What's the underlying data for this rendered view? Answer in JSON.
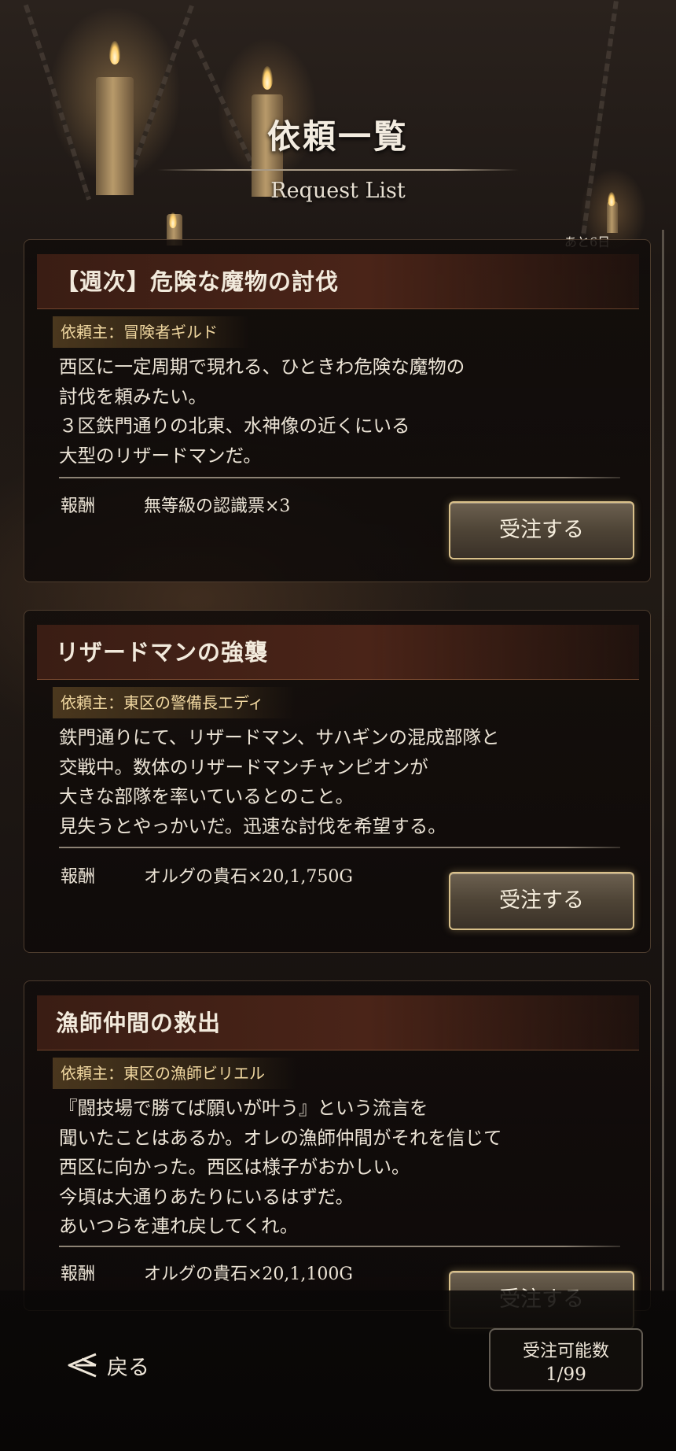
{
  "header": {
    "title": "依頼一覧",
    "subtitle": "Request List"
  },
  "scroll": {
    "remaining_label": "あと6日"
  },
  "requests": [
    {
      "title": "【週次】危険な魔物の討伐",
      "client": "依頼主：冒険者ギルド",
      "description": "西区に一定周期で現れる、ひときわ危険な魔物の\n討伐を頼みたい。\n３区鉄門通りの北東、水神像の近くにいる\n大型のリザードマンだ。",
      "reward_label": "報酬",
      "reward_value": "無等級の認識票×3",
      "accept_label": "受注する"
    },
    {
      "title": "リザードマンの強襲",
      "client": "依頼主：東区の警備長エディ",
      "description": "鉄門通りにて、リザードマン、サハギンの混成部隊と\n交戦中。数体のリザードマンチャンピオンが\n大きな部隊を率いているとのこと。\n見失うとやっかいだ。迅速な討伐を希望する。",
      "reward_label": "報酬",
      "reward_value": "オルグの貴石×20,1,750G",
      "accept_label": "受注する"
    },
    {
      "title": "漁師仲間の救出",
      "client": "依頼主：東区の漁師ビリエル",
      "description": "『闘技場で勝てば願いが叶う』という流言を\n聞いたことはあるか。オレの漁師仲間がそれを信じて\n西区に向かった。西区は様子がおかしい。\n今頃は大通りあたりにいるはずだ。\nあいつらを連れ戻してくれ。",
      "reward_label": "報酬",
      "reward_value": "オルグの貴石×20,1,100G",
      "accept_label": "受注する"
    }
  ],
  "footer": {
    "back_label": "戻る",
    "capacity_label": "受注可能数",
    "capacity_value": "1/99"
  },
  "colors": {
    "accent_gold": "#d9c08a",
    "title_band": "#4a2418",
    "client_band": "#7a5a2d"
  }
}
